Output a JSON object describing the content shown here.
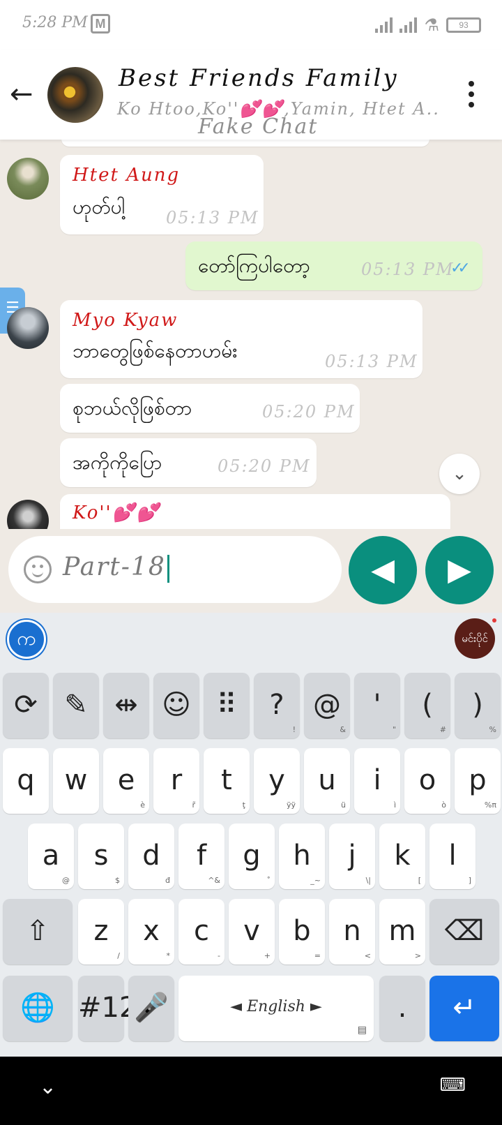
{
  "status_bar": {
    "time": "5:28 PM",
    "carrier_icon": "M",
    "battery": "93"
  },
  "header": {
    "title": "Best Friends Family",
    "members": "Ko Htoo,Ko''💕💕,Yamin, Htet A..",
    "subtitle_overlay": "Fake Chat",
    "icons": {
      "back": "arrow-left-icon",
      "menu": "more-vert-icon"
    }
  },
  "messages": [
    {
      "sender": "Htet Aung",
      "text": "ဟုတ်ပါ့",
      "time": "05:13 PM"
    },
    {
      "text": "တော်ကြပါတော့",
      "time": "05:13 PM",
      "outgoing": true,
      "ticks": "✓✓"
    },
    {
      "sender": "Myo Kyaw",
      "text": "ဘာတွေဖြစ်နေတာဟမ်း",
      "time": "05:13 PM"
    },
    {
      "text": "စုဘယ်လိုဖြစ်တာ",
      "time": "05:20 PM"
    },
    {
      "text": "အကိုကိုပြော",
      "time": "05:20 PM"
    },
    {
      "sender": "Ko''💕💕"
    }
  ],
  "composer": {
    "value": "Part-18",
    "left_button": "◀",
    "right_button": "▶"
  },
  "keyboard": {
    "logo": "က",
    "badge": "မင်းပိုင်",
    "row0": [
      {
        "main": "⟳"
      },
      {
        "main": "✎"
      },
      {
        "main": "⇹"
      },
      {
        "main": "☺"
      },
      {
        "main": "⠿"
      },
      {
        "main": "?",
        "sub": "!"
      },
      {
        "main": "@",
        "sub": "&"
      },
      {
        "main": "'",
        "sub": "\""
      },
      {
        "main": "(",
        "sub": "#"
      },
      {
        "main": ")",
        "sub": "%"
      }
    ],
    "row1": [
      {
        "main": "q"
      },
      {
        "main": "w"
      },
      {
        "main": "e",
        "sub": "è"
      },
      {
        "main": "r",
        "sub": "r̃"
      },
      {
        "main": "t",
        "sub": "ţ"
      },
      {
        "main": "y",
        "sub": "ÿÿ"
      },
      {
        "main": "u",
        "sub": "ü"
      },
      {
        "main": "i",
        "sub": "ì"
      },
      {
        "main": "o",
        "sub": "ò"
      },
      {
        "main": "p",
        "sub": "%π"
      }
    ],
    "row2": [
      {
        "main": "a",
        "sub": "@"
      },
      {
        "main": "s",
        "sub": "$"
      },
      {
        "main": "d",
        "sub": "đ"
      },
      {
        "main": "f",
        "sub": "^&"
      },
      {
        "main": "g",
        "sub": "˚"
      },
      {
        "main": "h",
        "sub": "_~"
      },
      {
        "main": "j",
        "sub": "\\|"
      },
      {
        "main": "k",
        "sub": "["
      },
      {
        "main": "l",
        "sub": "]"
      }
    ],
    "row3": [
      {
        "main": "z",
        "sub": "/"
      },
      {
        "main": "x",
        "sub": "*"
      },
      {
        "main": "c",
        "sub": "-"
      },
      {
        "main": "v",
        "sub": "+"
      },
      {
        "main": "b",
        "sub": "="
      },
      {
        "main": "n",
        "sub": "<"
      },
      {
        "main": "m",
        "sub": ">"
      }
    ],
    "shift": "⇧",
    "backspace": "⌫",
    "globe": "🌐",
    "numbers": "#12",
    "mic": "🎤",
    "space": "◄ English ►",
    "period": ".",
    "enter": "↵"
  },
  "nav_bar": {
    "down": "⌄",
    "keyboard": "⌨"
  }
}
